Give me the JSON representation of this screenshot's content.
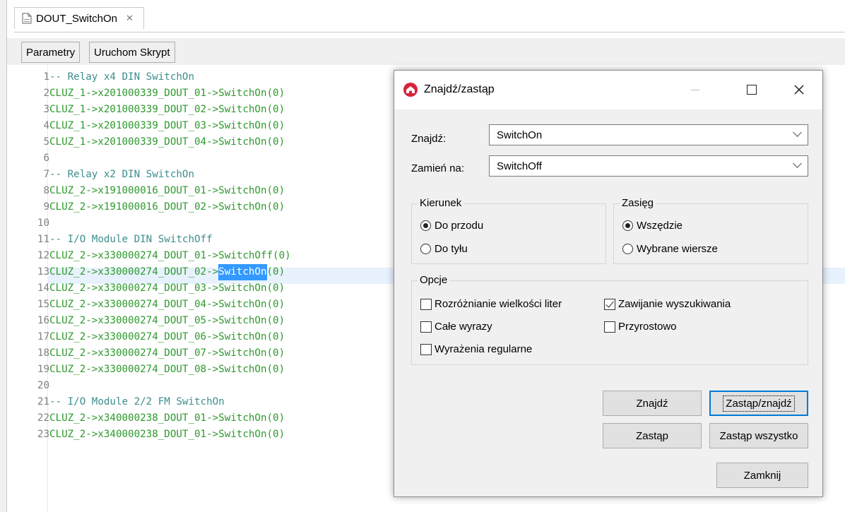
{
  "tab": {
    "title": "DOUT_SwitchOn",
    "close_glyph": "✕"
  },
  "toolbar": {
    "params_label": "Parametry",
    "run_label": "Uruchom Skrypt"
  },
  "editor": {
    "lines": [
      {
        "n": "1",
        "t": "-- Relay x4 DIN SwitchOn",
        "type": "comment"
      },
      {
        "n": "2",
        "t": "CLUZ_1->x201000339_DOUT_01->SwitchOn(0)",
        "type": "code"
      },
      {
        "n": "3",
        "t": "CLUZ_1->x201000339_DOUT_02->SwitchOn(0)",
        "type": "code"
      },
      {
        "n": "4",
        "t": "CLUZ_1->x201000339_DOUT_03->SwitchOn(0)",
        "type": "code"
      },
      {
        "n": "5",
        "t": "CLUZ_1->x201000339_DOUT_04->SwitchOn(0)",
        "type": "code"
      },
      {
        "n": "6",
        "t": "",
        "type": "code"
      },
      {
        "n": "7",
        "t": "-- Relay x2 DIN SwitchOn",
        "type": "comment"
      },
      {
        "n": "8",
        "t": "CLUZ_2->x191000016_DOUT_01->SwitchOn(0)",
        "type": "code"
      },
      {
        "n": "9",
        "t": "CLUZ_2->x191000016_DOUT_02->SwitchOn(0)",
        "type": "code"
      },
      {
        "n": "10",
        "t": "",
        "type": "code"
      },
      {
        "n": "11",
        "t": "-- I/O Module DIN SwitchOff",
        "type": "comment"
      },
      {
        "n": "12",
        "t": "CLUZ_2->x330000274_DOUT_01->SwitchOff(0)",
        "type": "code"
      },
      {
        "n": "13",
        "t": "CLUZ_2->x330000274_DOUT_02->",
        "sel": "SwitchOn",
        "after": "(0)",
        "type": "code"
      },
      {
        "n": "14",
        "t": "CLUZ_2->x330000274_DOUT_03->SwitchOn(0)",
        "type": "code"
      },
      {
        "n": "15",
        "t": "CLUZ_2->x330000274_DOUT_04->SwitchOn(0)",
        "type": "code"
      },
      {
        "n": "16",
        "t": "CLUZ_2->x330000274_DOUT_05->SwitchOn(0)",
        "type": "code"
      },
      {
        "n": "17",
        "t": "CLUZ_2->x330000274_DOUT_06->SwitchOn(0)",
        "type": "code"
      },
      {
        "n": "18",
        "t": "CLUZ_2->x330000274_DOUT_07->SwitchOn(0)",
        "type": "code"
      },
      {
        "n": "19",
        "t": "CLUZ_2->x330000274_DOUT_08->SwitchOn(0)",
        "type": "code"
      },
      {
        "n": "20",
        "t": "",
        "type": "code"
      },
      {
        "n": "21",
        "t": "-- I/O Module 2/2 FM SwitchOn",
        "type": "comment"
      },
      {
        "n": "22",
        "t": "CLUZ_2->x340000238_DOUT_01->SwitchOn(0)",
        "type": "code"
      },
      {
        "n": "23",
        "t": "CLUZ_2->x340000238_DOUT_01->SwitchOn(0)",
        "type": "code"
      }
    ]
  },
  "dialog": {
    "title": "Znajdź/zastąp",
    "find_label": "Znajdź:",
    "find_value": "SwitchOn",
    "replace_label": "Zamień na:",
    "replace_value": "SwitchOff",
    "direction": {
      "legend": "Kierunek",
      "forward": "Do przodu",
      "backward": "Do tyłu",
      "selected": "forward"
    },
    "scope": {
      "legend": "Zasięg",
      "all": "Wszędzie",
      "selected_lines": "Wybrane wiersze",
      "selected": "all"
    },
    "options": {
      "legend": "Opcje",
      "case_sensitive": {
        "label": "Rozróżnianie wielkości liter",
        "checked": false
      },
      "whole_words": {
        "label": "Całe wyrazy",
        "checked": false
      },
      "regex": {
        "label": "Wyrażenia regularne",
        "checked": false
      },
      "wrap": {
        "label": "Zawijanie wyszukiwania",
        "checked": true
      },
      "incremental": {
        "label": "Przyrostowo",
        "checked": false
      }
    },
    "buttons": {
      "find": "Znajdź",
      "replace_find": "Zastąp/znajdź",
      "replace": "Zastąp",
      "replace_all": "Zastąp wszystko",
      "close": "Zamknij"
    }
  },
  "colors": {
    "code_green": "#2e9a2e",
    "comment_teal": "#3d8e8e",
    "selection": "#3399ff",
    "line_highlight": "#e8f2fe",
    "accent": "#0078d7"
  }
}
